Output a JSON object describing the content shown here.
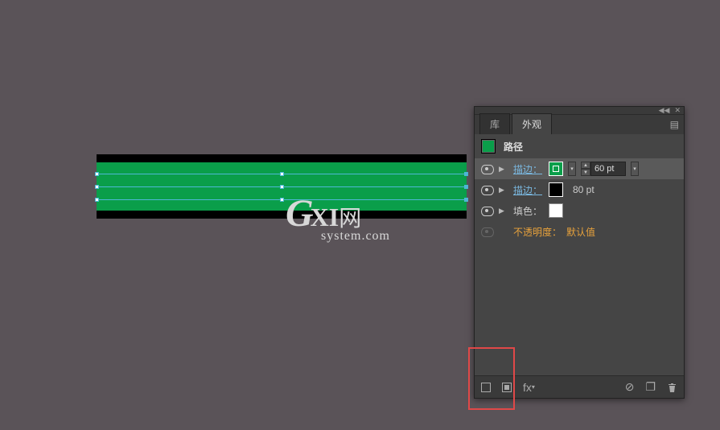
{
  "canvas": {
    "green_color": "#0a9e4a",
    "black_color": "#000000"
  },
  "watermark": {
    "main": "GXI网",
    "sub": "system.com"
  },
  "panel": {
    "tabs": [
      {
        "label": "库",
        "active": false
      },
      {
        "label": "外观",
        "active": true
      }
    ],
    "header": {
      "swatch_color": "#0a9e4a",
      "title": "路径"
    },
    "rows": [
      {
        "type": "stroke",
        "label": "描边：",
        "selected": true,
        "swatch_bg": "#0a9e4a",
        "swatch_inner": "#0a9e4a",
        "value": "60 pt",
        "has_stepper": true,
        "link": true
      },
      {
        "type": "stroke",
        "label": "描边：",
        "selected": false,
        "swatch_bg": "#000000",
        "value": "80 pt",
        "has_stepper": false,
        "link": true
      },
      {
        "type": "fill",
        "label": "填色：",
        "selected": false,
        "swatch_bg": "#ffffff"
      },
      {
        "type": "opacity",
        "label": "不透明度：",
        "value": "默认值"
      }
    ]
  },
  "icons": {
    "chevrons": "◀◀",
    "close": "✕",
    "menu": "▤",
    "triangle": "▶",
    "dd": "▾",
    "up": "▲",
    "down": "▼",
    "fx": "fx",
    "no": "⊘",
    "dup": "⬚",
    "trash": "🗑"
  }
}
